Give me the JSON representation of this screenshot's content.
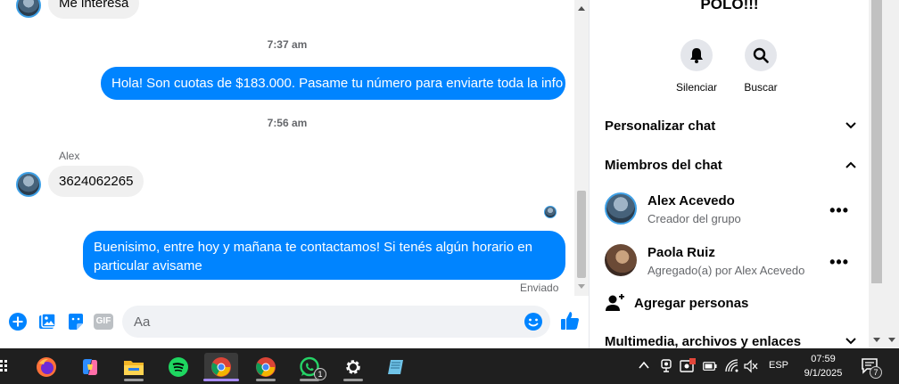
{
  "chat": {
    "top_message": "Me interesa",
    "messages": [
      {
        "type": "timestamp",
        "text": "7:37 am"
      },
      {
        "type": "outgoing",
        "text": "Hola! Son cuotas de $183.000. Pasame tu número para enviarte toda la info"
      },
      {
        "type": "timestamp",
        "text": "7:56 am"
      },
      {
        "type": "sender",
        "text": "Alex"
      },
      {
        "type": "incoming",
        "text": "3624062265"
      },
      {
        "type": "outgoing",
        "text": "Buenisimo, entre hoy y mañana te contactamos! Si tenés algún horario en particular avisame"
      }
    ],
    "status": "Enviado"
  },
  "composer": {
    "placeholder": "Aa",
    "icons": [
      "plus-circle-icon",
      "photo-icon",
      "sticker-icon",
      "gif-icon",
      "emoji-icon",
      "thumbs-up-icon"
    ],
    "gif_label": "GIF"
  },
  "panel": {
    "group_title": "POLO!!!",
    "actions": [
      {
        "label": "Silenciar",
        "icon": "bell-icon"
      },
      {
        "label": "Buscar",
        "icon": "search-icon"
      }
    ],
    "sections": {
      "customize": "Personalizar chat",
      "members": "Miembros del chat",
      "media": "Multimedia, archivos y enlaces"
    },
    "members": [
      {
        "name": "Alex Acevedo",
        "role": "Creador del grupo"
      },
      {
        "name": "Paola Ruiz",
        "role": "Agregado(a) por Alex Acevedo"
      }
    ],
    "add_people": "Agregar personas",
    "more_label": "•••"
  },
  "taskbar": {
    "apps": [
      "firefox-icon",
      "copilot-icon",
      "file-explorer-icon",
      "spotify-icon",
      "chrome-icon",
      "chrome-icon",
      "whatsapp-icon",
      "settings-icon",
      "notepad-icon"
    ],
    "whatsapp_badge": "1",
    "language": "ESP",
    "time": "07:59",
    "date": "9/1/2025",
    "notification_count": "7"
  },
  "colors": {
    "accent": "#0084ff",
    "incoming_bubble": "#f0f0f0",
    "taskbar": "#1f1f1f"
  }
}
